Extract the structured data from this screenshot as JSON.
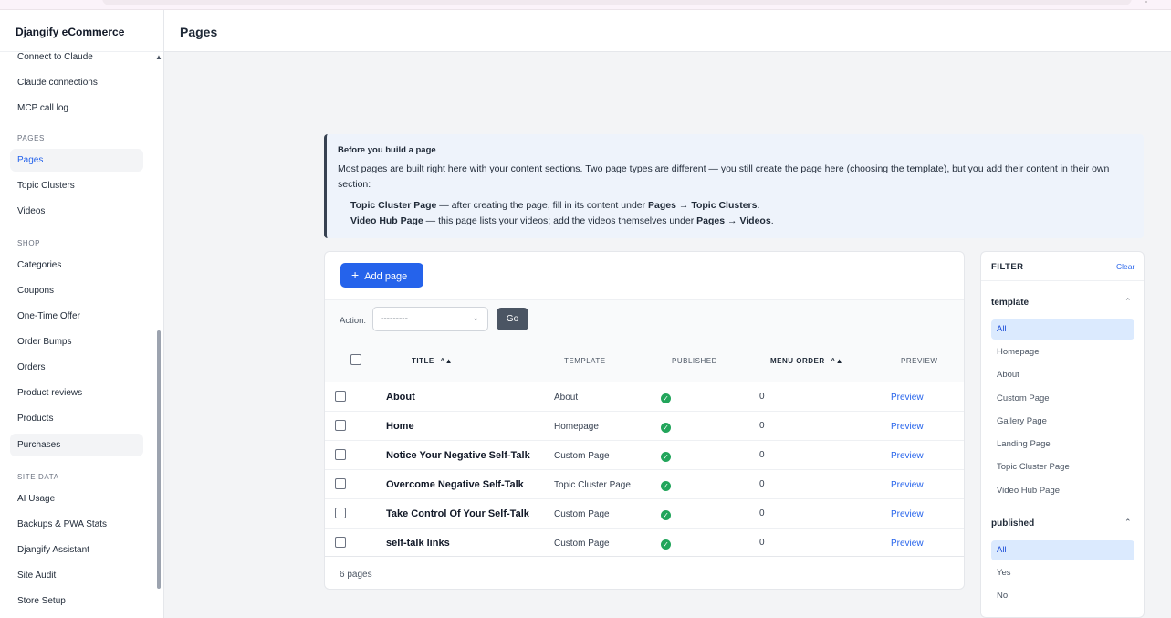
{
  "sidebar": {
    "brand": "Djangify eCommerce",
    "items": [
      {
        "label": "Connect to Claude"
      },
      {
        "label": "Claude connections"
      },
      {
        "label": "MCP call log"
      },
      {
        "label": "Pages"
      },
      {
        "label": "Topic Clusters"
      },
      {
        "label": "Videos"
      },
      {
        "label": "Categories"
      },
      {
        "label": "Coupons"
      },
      {
        "label": "One-Time Offer"
      },
      {
        "label": "Order Bumps"
      },
      {
        "label": "Orders"
      },
      {
        "label": "Product reviews"
      },
      {
        "label": "Products"
      },
      {
        "label": "Purchases"
      },
      {
        "label": "AI Usage"
      },
      {
        "label": "Backups & PWA Stats"
      },
      {
        "label": "Djangify Assistant"
      },
      {
        "label": "Site Audit"
      },
      {
        "label": "Store Setup"
      }
    ],
    "sections": {
      "pages": "PAGES",
      "shop": "SHOP",
      "site_data": "SITE DATA"
    }
  },
  "header": {
    "title": "Pages"
  },
  "info": {
    "title": "Before you build a page",
    "body": "Most pages are built right here with your content sections. Two page types are different — you still create the page here (choosing the template), but you add their content in their own section:",
    "line1": {
      "name": "Topic Cluster Page",
      "text": " — after creating the page, fill in its content under ",
      "path": "Pages → Topic Clusters",
      "end": "."
    },
    "line2": {
      "name": "Video Hub Page",
      "text": " — this page lists your videos; add the videos themselves under ",
      "path": "Pages → Videos",
      "end": "."
    }
  },
  "toolbar": {
    "add_label": "Add page",
    "action_label": "Action:",
    "action_value": "---------",
    "go_label": "Go"
  },
  "table": {
    "columns": {
      "title": "TITLE",
      "template": "TEMPLATE",
      "published": "PUBLISHED",
      "menu_order": "MENU ORDER",
      "preview": "PREVIEW"
    },
    "sort_glyph": "^▲",
    "rows": [
      {
        "title": "About",
        "template": "About",
        "published": true,
        "menu_order": "0",
        "preview": "Preview"
      },
      {
        "title": "Home",
        "template": "Homepage",
        "published": true,
        "menu_order": "0",
        "preview": "Preview"
      },
      {
        "title": "Notice Your Negative Self-Talk",
        "template": "Custom Page",
        "published": true,
        "menu_order": "0",
        "preview": "Preview"
      },
      {
        "title": "Overcome Negative Self-Talk",
        "template": "Topic Cluster Page",
        "published": true,
        "menu_order": "0",
        "preview": "Preview"
      },
      {
        "title": "Take Control Of Your Self-Talk",
        "template": "Custom Page",
        "published": true,
        "menu_order": "0",
        "preview": "Preview"
      },
      {
        "title": "self-talk links",
        "template": "Custom Page",
        "published": true,
        "menu_order": "0",
        "preview": "Preview"
      }
    ],
    "count": "6 pages"
  },
  "filter": {
    "title": "FILTER",
    "clear": "Clear",
    "template": {
      "label": "template",
      "options": [
        "All",
        "Homepage",
        "About",
        "Custom Page",
        "Gallery Page",
        "Landing Page",
        "Topic Cluster Page",
        "Video Hub Page"
      ],
      "selected": "All"
    },
    "published": {
      "label": "published",
      "options": [
        "All",
        "Yes",
        "No"
      ],
      "selected": "All"
    }
  },
  "colors": {
    "accent": "#2563eb",
    "success": "#22a55b",
    "info_bg": "#eef3fb"
  }
}
